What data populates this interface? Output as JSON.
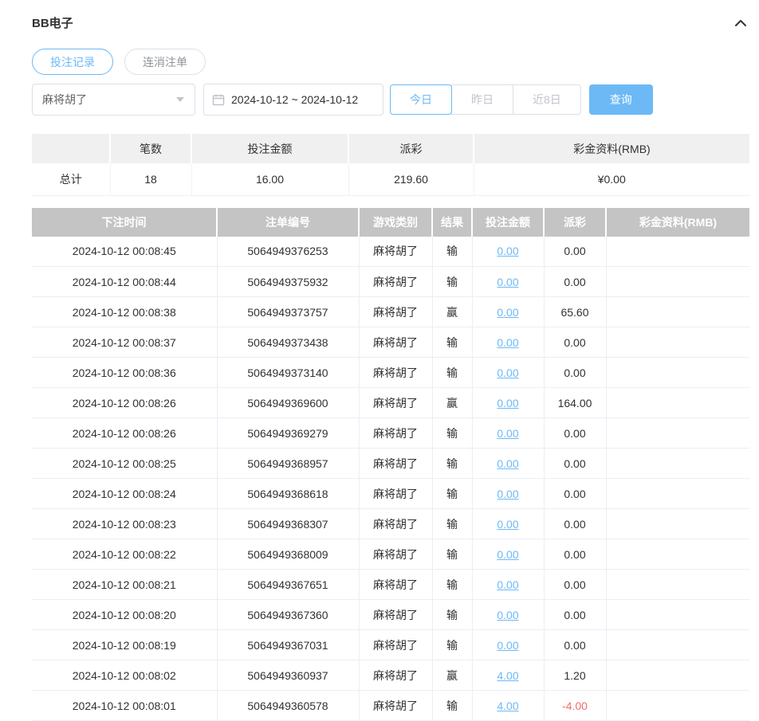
{
  "panel": {
    "title": "BB电子"
  },
  "tabs": [
    {
      "label": "投注记录",
      "active": true
    },
    {
      "label": "连消注单",
      "active": false
    }
  ],
  "filters": {
    "game_select": {
      "value": "麻将胡了"
    },
    "date_range": {
      "value": "2024-10-12 ~ 2024-10-12"
    },
    "quick_ranges": [
      {
        "label": "今日",
        "active": true
      },
      {
        "label": "昨日",
        "active": false
      },
      {
        "label": "近8日",
        "active": false
      }
    ],
    "search_button": "查询"
  },
  "summary": {
    "headers": [
      "",
      "笔数",
      "投注金额",
      "派彩",
      "彩金资料(RMB)"
    ],
    "total": {
      "label": "总计",
      "count": "18",
      "bet_amount": "16.00",
      "payout": "219.60",
      "bonus": "¥0.00"
    }
  },
  "bet_table": {
    "headers": [
      "下注时间",
      "注单编号",
      "游戏类别",
      "结果",
      "投注金额",
      "派彩",
      "彩金资料(RMB)"
    ],
    "rows": [
      {
        "time": "2024-10-12 00:08:45",
        "order_id": "5064949376253",
        "game": "麻将胡了",
        "result": "输",
        "bet": "0.00",
        "payout": "0.00",
        "bonus": ""
      },
      {
        "time": "2024-10-12 00:08:44",
        "order_id": "5064949375932",
        "game": "麻将胡了",
        "result": "输",
        "bet": "0.00",
        "payout": "0.00",
        "bonus": ""
      },
      {
        "time": "2024-10-12 00:08:38",
        "order_id": "5064949373757",
        "game": "麻将胡了",
        "result": "赢",
        "bet": "0.00",
        "payout": "65.60",
        "bonus": ""
      },
      {
        "time": "2024-10-12 00:08:37",
        "order_id": "5064949373438",
        "game": "麻将胡了",
        "result": "输",
        "bet": "0.00",
        "payout": "0.00",
        "bonus": ""
      },
      {
        "time": "2024-10-12 00:08:36",
        "order_id": "5064949373140",
        "game": "麻将胡了",
        "result": "输",
        "bet": "0.00",
        "payout": "0.00",
        "bonus": ""
      },
      {
        "time": "2024-10-12 00:08:26",
        "order_id": "5064949369600",
        "game": "麻将胡了",
        "result": "赢",
        "bet": "0.00",
        "payout": "164.00",
        "bonus": ""
      },
      {
        "time": "2024-10-12 00:08:26",
        "order_id": "5064949369279",
        "game": "麻将胡了",
        "result": "输",
        "bet": "0.00",
        "payout": "0.00",
        "bonus": ""
      },
      {
        "time": "2024-10-12 00:08:25",
        "order_id": "5064949368957",
        "game": "麻将胡了",
        "result": "输",
        "bet": "0.00",
        "payout": "0.00",
        "bonus": ""
      },
      {
        "time": "2024-10-12 00:08:24",
        "order_id": "5064949368618",
        "game": "麻将胡了",
        "result": "输",
        "bet": "0.00",
        "payout": "0.00",
        "bonus": ""
      },
      {
        "time": "2024-10-12 00:08:23",
        "order_id": "5064949368307",
        "game": "麻将胡了",
        "result": "输",
        "bet": "0.00",
        "payout": "0.00",
        "bonus": ""
      },
      {
        "time": "2024-10-12 00:08:22",
        "order_id": "5064949368009",
        "game": "麻将胡了",
        "result": "输",
        "bet": "0.00",
        "payout": "0.00",
        "bonus": ""
      },
      {
        "time": "2024-10-12 00:08:21",
        "order_id": "5064949367651",
        "game": "麻将胡了",
        "result": "输",
        "bet": "0.00",
        "payout": "0.00",
        "bonus": ""
      },
      {
        "time": "2024-10-12 00:08:20",
        "order_id": "5064949367360",
        "game": "麻将胡了",
        "result": "输",
        "bet": "0.00",
        "payout": "0.00",
        "bonus": ""
      },
      {
        "time": "2024-10-12 00:08:19",
        "order_id": "5064949367031",
        "game": "麻将胡了",
        "result": "输",
        "bet": "0.00",
        "payout": "0.00",
        "bonus": ""
      },
      {
        "time": "2024-10-12 00:08:02",
        "order_id": "5064949360937",
        "game": "麻将胡了",
        "result": "赢",
        "bet": "4.00",
        "payout": "1.20",
        "bonus": ""
      },
      {
        "time": "2024-10-12 00:08:01",
        "order_id": "5064949360578",
        "game": "麻将胡了",
        "result": "输",
        "bet": "4.00",
        "payout": "-4.00",
        "bonus": ""
      }
    ]
  },
  "colors": {
    "accent": "#6cb9f6",
    "negative": "#f56c6c",
    "table-header-bg": "#c4c4c4"
  }
}
